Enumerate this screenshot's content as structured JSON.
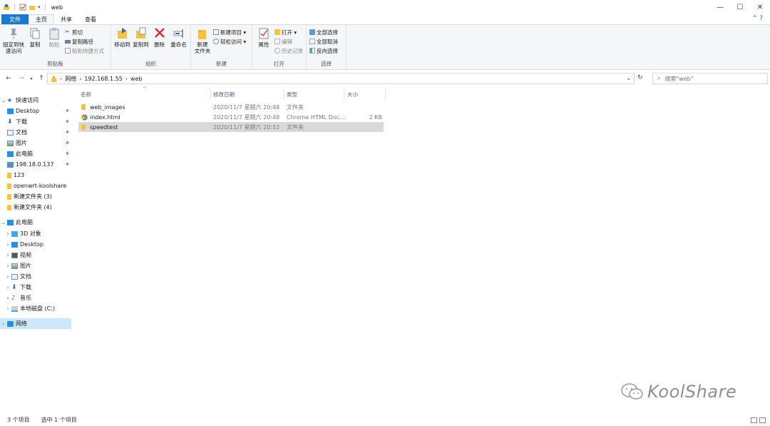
{
  "window": {
    "title": "web",
    "controls": {
      "minimize": "—",
      "maximize": "☐",
      "close": "✕"
    }
  },
  "ribbon_tabs": [
    "文件",
    "主页",
    "共享",
    "查看"
  ],
  "ribbon": {
    "clipboard": {
      "label": "剪贴板",
      "pin": "固定到快\n速访问",
      "copy": "复制",
      "paste": "粘贴",
      "cut": "剪切",
      "copy_path": "复制路径",
      "paste_shortcut": "粘贴快捷方式"
    },
    "organize": {
      "label": "组织",
      "move_to": "移动到",
      "copy_to": "复制到",
      "delete": "删除",
      "rename": "重命名"
    },
    "new": {
      "label": "新建",
      "new_folder": "新建\n文件夹",
      "new_item": "新建项目 ▾",
      "easy_access": "轻松访问 ▾"
    },
    "open": {
      "label": "打开",
      "properties": "属性",
      "open": "打开 ▾",
      "edit": "编辑",
      "history": "历史记录"
    },
    "select": {
      "label": "选择",
      "select_all": "全部选择",
      "select_none": "全部取消",
      "invert": "反向选择"
    }
  },
  "address": {
    "crumbs": [
      "网络",
      "192.168.1.55",
      "web"
    ],
    "search_placeholder": "搜索\"web\""
  },
  "nav_pane": {
    "quick_access": "快速访问",
    "quick_items": [
      "Desktop",
      "下载",
      "文档",
      "图片",
      "此电脑",
      "198.18.0.137",
      "123",
      "openwrt-koolshare",
      "新建文件夹 (3)",
      "新建文件夹 (4)"
    ],
    "this_pc": "此电脑",
    "pc_items": [
      "3D 对象",
      "Desktop",
      "视频",
      "图片",
      "文档",
      "下载",
      "音乐",
      "本地磁盘 (C:)"
    ],
    "network": "网络"
  },
  "columns": {
    "name": "名称",
    "date": "修改日期",
    "type": "类型",
    "size": "大小"
  },
  "files": [
    {
      "name": "web_images",
      "date": "2020/11/7 星期六 20:48",
      "type": "文件夹",
      "size": "",
      "icon": "folder-icon"
    },
    {
      "name": "index.html",
      "date": "2020/11/7 星期六 20:48",
      "type": "Chrome HTML Doc...",
      "size": "2 KB",
      "icon": "chrome-icon"
    },
    {
      "name": "speedtest",
      "date": "2020/11/7 星期六 20:52",
      "type": "文件夹",
      "size": "",
      "icon": "folder-icon"
    }
  ],
  "status": {
    "count": "3 个项目",
    "selected": "选中 1 个项目"
  },
  "watermark": {
    "text": "KoolShare"
  },
  "colors": {
    "accent": "#1979ca",
    "selection": "#cce8ff",
    "row_selected": "#d9d9d9",
    "folder": "#f5c342"
  }
}
